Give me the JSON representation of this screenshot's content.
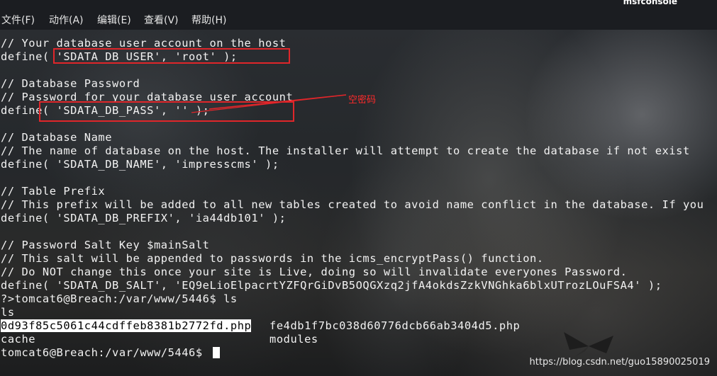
{
  "window": {
    "title": "msfconsole"
  },
  "menu": {
    "items": [
      {
        "label": "文件(F)"
      },
      {
        "label": "动作(A)"
      },
      {
        "label": "编辑(E)"
      },
      {
        "label": "查看(V)"
      },
      {
        "label": "帮助(H)"
      }
    ]
  },
  "terminal": {
    "lines": [
      "// Your database user account on the host",
      "define( 'SDATA_DB_USER', 'root' );",
      "",
      "// Database Password",
      "// Password for your database user account",
      "define( 'SDATA_DB_PASS', '' );",
      "",
      "// Database Name",
      "// The name of database on the host. The installer will attempt to create the database if not exist",
      "define( 'SDATA_DB_NAME', 'impresscms' );",
      "",
      "// Table Prefix",
      "// This prefix will be added to all new tables created to avoid name conflict in the database. If you",
      "define( 'SDATA_DB_PREFIX', 'ia44db101' );",
      "",
      "// Password Salt Key $mainSalt",
      "// This salt will be appended to passwords in the icms_encryptPass() function.",
      "// Do NOT change this once your site is Live, doing so will invalidate everyones Password.",
      "define( 'SDATA_DB_SALT', 'EQ9eLioElpacrtYZFQrGiDvB5OQGXzq2jfA4okdsZzkVNGhka6blxUTrozLOuFSA4' );",
      "?>tomcat6@Breach:/var/www/5446$ ls",
      "ls"
    ],
    "listing": {
      "col1": [
        "0d93f85c5061c44cdffeb8381b2772fd.php",
        "cache"
      ],
      "col2": [
        "fe4db1f7bc038d60776dcb66ab3404d5.php",
        "modules"
      ]
    },
    "prompt": "tomcat6@Breach:/var/www/5446$ "
  },
  "annotation": {
    "label": "空密码",
    "color": "#e0262a"
  },
  "watermark": {
    "text": "https://blog.csdn.net/guo15890025019"
  }
}
